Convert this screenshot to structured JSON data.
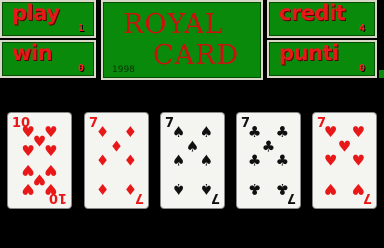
{
  "panels": {
    "play": {
      "label": "play",
      "value": "1"
    },
    "win": {
      "label": "win",
      "value": "0"
    },
    "credit": {
      "label": "credit",
      "value": "4"
    },
    "punti": {
      "label": "punti",
      "value": "0"
    }
  },
  "title": {
    "line1": "ROYAL",
    "line2": "CARD",
    "year": "1998"
  },
  "colors": {
    "panel_green": "#0a8a0a",
    "label_red": "#e81818",
    "title_red": "#cc1010",
    "card_bg": "#f4f4f0"
  },
  "cards": [
    {
      "rank": "10",
      "suit": "hearts"
    },
    {
      "rank": "7",
      "suit": "diamonds"
    },
    {
      "rank": "7",
      "suit": "spades"
    },
    {
      "rank": "7",
      "suit": "clubs"
    },
    {
      "rank": "7",
      "suit": "hearts"
    }
  ]
}
